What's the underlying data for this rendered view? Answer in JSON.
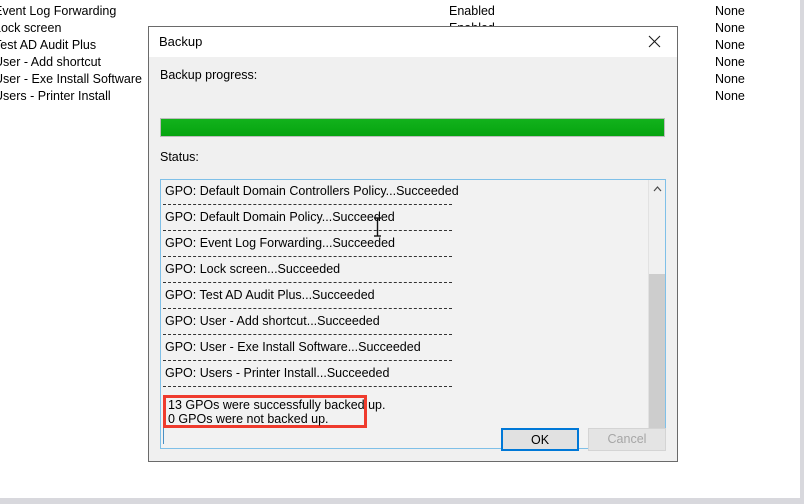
{
  "background_window": {
    "name_column": [
      "Event Log Forwarding",
      "Lock screen",
      "Test AD Audit Plus",
      "User - Add shortcut",
      "User - Exe Install Software",
      "Users - Printer Install"
    ],
    "status_column": [
      "Enabled",
      "Enabled"
    ],
    "none_column": [
      "None",
      "None",
      "None",
      "None",
      "None",
      "None"
    ]
  },
  "dialog": {
    "title": "Backup",
    "close_icon": "close-icon",
    "progress": {
      "label": "Backup progress:",
      "percent": 100,
      "fill_color": "#0BA80E"
    },
    "status": {
      "label": "Status:",
      "rows": [
        "GPO: Default Domain Controllers Policy...Succeeded",
        "GPO: Default Domain Policy...Succeeded",
        "GPO: Event Log Forwarding...Succeeded",
        "GPO: Lock screen...Succeeded",
        "GPO: Test AD Audit Plus...Succeeded",
        "GPO: User - Add shortcut...Succeeded",
        "GPO: User - Exe Install Software...Succeeded",
        "GPO: Users - Printer Install...Succeeded"
      ],
      "summary": {
        "line1": "13 GPOs were successfully backed up.",
        "line2": "0 GPOs were not backed up.",
        "highlight_color": "#ef3b2d"
      },
      "scrollbar": {
        "up_arrow_icon": "chevron-up-icon",
        "down_arrow_icon": "chevron-down-icon"
      }
    },
    "buttons": {
      "ok": "OK",
      "cancel": "Cancel"
    }
  }
}
